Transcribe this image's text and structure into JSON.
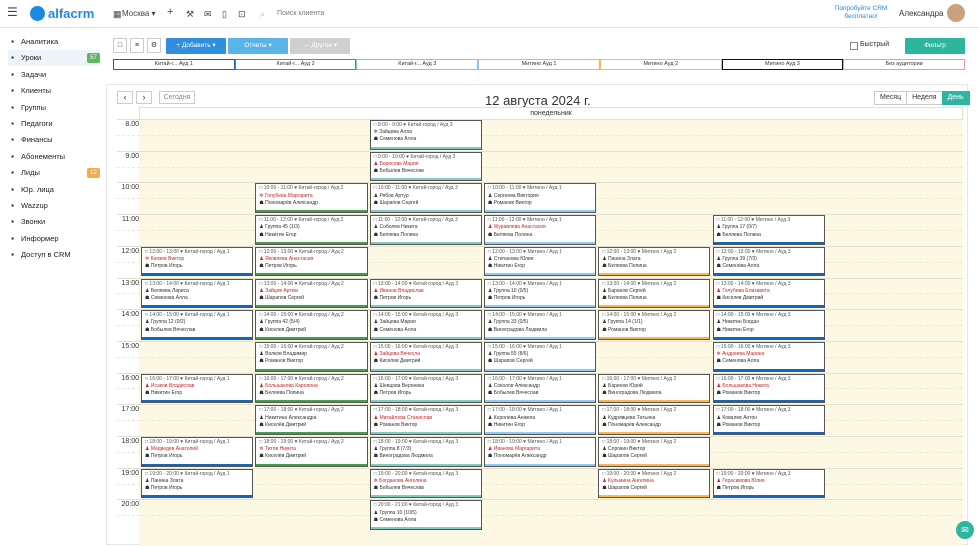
{
  "header": {
    "logo": "alfacrm",
    "city": "Москва",
    "search_placeholder": "Поиск клиента",
    "promo": "Попробуйте CRM бесплатно!",
    "user": "Александра"
  },
  "sidebar": [
    {
      "label": "Аналитика",
      "icon": "analytics-icon"
    },
    {
      "label": "Уроки",
      "icon": "lessons-icon",
      "badge": "57",
      "badge_color": "#5cb85c",
      "active": true
    },
    {
      "label": "Задачи",
      "icon": "tasks-icon"
    },
    {
      "label": "Клиенты",
      "icon": "clients-icon"
    },
    {
      "label": "Группы",
      "icon": "groups-icon"
    },
    {
      "label": "Педагоги",
      "icon": "teachers-icon"
    },
    {
      "label": "Финансы",
      "icon": "finance-icon"
    },
    {
      "label": "Абонементы",
      "icon": "subscriptions-icon"
    },
    {
      "label": "Лиды",
      "icon": "leads-icon",
      "badge": "12",
      "badge_color": "#f0ad4e"
    },
    {
      "label": "Юр. лица",
      "icon": "legal-icon"
    },
    {
      "label": "Wazzup",
      "icon": "wazzup-icon"
    },
    {
      "label": "Звонки",
      "icon": "calls-icon"
    },
    {
      "label": "Информер",
      "icon": "informer-icon"
    },
    {
      "label": "Доступ в CRM",
      "icon": "lock-icon"
    }
  ],
  "toolbar": {
    "add": "+ Добавить ▾",
    "reports": "Отчеты ▾",
    "other": "— Другое ▾",
    "quick": "Быстрый",
    "filter": "Фильтр"
  },
  "rooms": [
    {
      "label": "Китай-г... Ауд 1",
      "color": "#1565c0"
    },
    {
      "label": "Китай-г... Ауд 2",
      "color": "#43a047"
    },
    {
      "label": "Китай-г... Ауд 3",
      "color": "#80cbc4"
    },
    {
      "label": "Митино Ауд 1",
      "color": "#90caf9"
    },
    {
      "label": "Митино Ауд 2",
      "color": "#ffb74d"
    },
    {
      "label": "Митино Ауд 3",
      "color": "#111111"
    },
    {
      "label": "Без аудитории",
      "color": "#ef9a9a"
    }
  ],
  "calendar": {
    "today": "Сегодня",
    "title": "12 августа 2024 г.",
    "views": [
      "Месяц",
      "Неделя",
      "День"
    ],
    "active_view": "День",
    "day": "понедельник",
    "hours": [
      "8.00",
      "9.00",
      "10:00",
      "11:00",
      "12:00",
      "13:00",
      "14:00",
      "15:00",
      "16:00",
      "17:00",
      "18:00",
      "19:00",
      "20:00"
    ]
  },
  "lessons": [
    {
      "c": 2,
      "h": 0,
      "l": [
        "□ 8:00 - 9:00 ♥ Китай-город / Ауд 3",
        "✲ Зайцева Алла",
        "☗ Семенова Алла"
      ],
      "red": []
    },
    {
      "c": 2,
      "h": 1,
      "l": [
        "□ 9:00 - 10:00 ♥ Китай-город / Ауд 3",
        "♟ Борисова Мария",
        "☗ Бобылев Вячеслав"
      ],
      "red": [
        1
      ]
    },
    {
      "c": 1,
      "h": 2,
      "l": [
        "□ 10:00 - 11:00 ♥ Китай-город / Ауд 2",
        "✲ Голубева Маргарита",
        "☗ Пономарёв Александр"
      ],
      "red": [
        1
      ]
    },
    {
      "c": 2,
      "h": 2,
      "l": [
        "□ 10:00 - 11:00 ♥ Китай-город / Ауд 3",
        "♟ Рябов Артур",
        "☗ Шарапов Сергей"
      ],
      "red": []
    },
    {
      "c": 3,
      "h": 2,
      "l": [
        "□ 10:00 - 11:00 ♥ Митино / Ауд 1",
        "♟ Сергеева Виктория",
        "☗ Романов Виктор"
      ],
      "red": []
    },
    {
      "c": 1,
      "h": 3,
      "l": [
        "□ 11:00 - 12:00 ♥ Китай-город / Ауд 2",
        "♟ Группа 45 (1/3)",
        "☗ Никитин Егор"
      ],
      "red": []
    },
    {
      "c": 2,
      "h": 3,
      "l": [
        "□ 11:00 - 12:00 ♥ Китай-город / Ауд 3",
        "♟ Соболев Никита",
        "☗ Беляева Полина"
      ],
      "red": []
    },
    {
      "c": 3,
      "h": 3,
      "l": [
        "□ 11:00 - 12:00 ♥ Митино / Ауд 1",
        "♟ Журавлева Анастасия",
        "☗ Беляева Полина"
      ],
      "red": [
        1
      ]
    },
    {
      "c": 5,
      "h": 3,
      "l": [
        "□ 11:00 - 12:00 ♥ Митино / Ауд 3",
        "♟ Группа 17 (0/7)",
        "☗ Беляева Полина"
      ],
      "red": []
    },
    {
      "c": 0,
      "h": 4,
      "l": [
        "□ 12:00 - 13:00 ♥ Китай-город / Ауд 1",
        "✲ Князев Виктор",
        "☗ Петров Игорь"
      ],
      "red": [
        1
      ]
    },
    {
      "c": 1,
      "h": 4,
      "l": [
        "□ 12:00 - 13:00 ♥ Китай-город / Ауд 2",
        "♟ Яковлева Анастасия",
        "☗ Петров Игорь"
      ],
      "red": [
        1
      ]
    },
    {
      "c": 3,
      "h": 4,
      "l": [
        "□ 12:00 - 13:00 ♥ Митино / Ауд 1",
        "♟ Степанова Юлия",
        "☗ Никитин Егор"
      ],
      "red": []
    },
    {
      "c": 4,
      "h": 4,
      "l": [
        "□ 12:00 - 13:00 ♥ Митино / Ауд 2",
        "♟ Панина Злата",
        "☗ Беляева Полина"
      ],
      "red": []
    },
    {
      "c": 5,
      "h": 4,
      "l": [
        "□ 12:00 - 13:00 ♥ Митино / Ауд 3",
        "♟ Группа 39 (7/3)",
        "☗ Семенова Алла"
      ],
      "red": []
    },
    {
      "c": 0,
      "h": 5,
      "l": [
        "□ 13:00 - 14:00 ♥ Китай-город / Ауд 1",
        "♟ Беляева Лариса",
        "☗ Семенова Алла"
      ],
      "red": []
    },
    {
      "c": 1,
      "h": 5,
      "l": [
        "□ 13:00 - 14:00 ♥ Китай-город / Ауд 2",
        "♟ Зайцев Артем",
        "☗ Шарапов Сергей"
      ],
      "red": [
        1
      ]
    },
    {
      "c": 2,
      "h": 5,
      "l": [
        "□ 13:00 - 14:00 ♥ Китай-город / Ауд 3",
        "♟ Иванов Владислав",
        "☗ Петров Игорь"
      ],
      "red": [
        1
      ]
    },
    {
      "c": 3,
      "h": 5,
      "l": [
        "□ 13:00 - 14:00 ♥ Митино / Ауд 1",
        "♟ Группа 10 (0/5)",
        "☗ Петров Игорь"
      ],
      "red": []
    },
    {
      "c": 4,
      "h": 5,
      "l": [
        "□ 13:00 - 14:00 ♥ Митино / Ауд 2",
        "♟ Баранов Сергей",
        "☗ Беляева Полина"
      ],
      "red": []
    },
    {
      "c": 5,
      "h": 5,
      "l": [
        "□ 13:00 - 14:00 ♥ Митино / Ауд 3",
        "♟ Голубева Елизавета",
        "☗ Киселев Дмитрий"
      ],
      "red": [
        1
      ]
    },
    {
      "c": 0,
      "h": 6,
      "l": [
        "□ 14:00 - 15:00 ♥ Китай-город / Ауд 1",
        "♟ Группа 12 (0/2)",
        "☗ Бобылев Вячеслав"
      ],
      "red": []
    },
    {
      "c": 1,
      "h": 6,
      "l": [
        "□ 14:00 - 15:00 ♥ Китай-город / Ауд 2",
        "♟ Группа 42 (5/4)",
        "☗ Киселев Дмитрий"
      ],
      "red": []
    },
    {
      "c": 2,
      "h": 6,
      "l": [
        "□ 14:00 - 15:00 ♥ Китай-город / Ауд 3",
        "♟ Зайцева Мария",
        "☗ Семенова Алла"
      ],
      "red": []
    },
    {
      "c": 3,
      "h": 6,
      "l": [
        "□ 14:00 - 15:00 ♥ Митино / Ауд 1",
        "♟ Группа 33 (0/5)",
        "☗ Виноградова Людмила"
      ],
      "red": []
    },
    {
      "c": 4,
      "h": 6,
      "l": [
        "□ 14:00 - 15:00 ♥ Митино / Ауд 2",
        "♟ Группа 14 (1/1)",
        "☗ Романов Виктор"
      ],
      "red": []
    },
    {
      "c": 5,
      "h": 6,
      "l": [
        "□ 14:00 - 15:00 ♥ Митино / Ауд 3",
        "♟ Никитин Богдан",
        "☗ Никитин Егор"
      ],
      "red": []
    },
    {
      "c": 1,
      "h": 7,
      "l": [
        "□ 15:00 - 16:00 ♥ Китай-город / Ауд 2",
        "♟ Волков Владимир",
        "☗ Романов Виктор"
      ],
      "red": []
    },
    {
      "c": 2,
      "h": 7,
      "l": [
        "□ 15:00 - 16:00 ♥ Китай-город / Ауд 3",
        "♟ Зайцева Вячесла",
        "☗ Киселев Дмитрий"
      ],
      "red": [
        1
      ]
    },
    {
      "c": 3,
      "h": 7,
      "l": [
        "□ 15:00 - 16:00 ♥ Митино / Ауд 1",
        "♟ Группа 55 (8/6)",
        "☗ Шарапов Сергей"
      ],
      "red": []
    },
    {
      "c": 5,
      "h": 7,
      "l": [
        "□ 15:00 - 16:00 ♥ Митино / Ауд 3",
        "✲ Андреева Марина",
        "☗ Семенова Алла"
      ],
      "red": [
        1
      ]
    },
    {
      "c": 0,
      "h": 8,
      "l": [
        "□ 16:00 - 17:00 ♥ Китай-город / Ауд 1",
        "♟ Исаков Владислав",
        "☗ Никитин Егор"
      ],
      "red": [
        1
      ]
    },
    {
      "c": 1,
      "h": 8,
      "l": [
        "□ 16:00 - 17:00 ♥ Китай-город / Ауд 2",
        "♟ Большакова Каролина",
        "☗ Беляева Полина"
      ],
      "red": [
        1
      ]
    },
    {
      "c": 2,
      "h": 8,
      "l": [
        "□ 16:00 - 17:00 ♥ Китай-город / Ауд 3",
        "♟ Шевцова Вероника",
        "☗ Петров Игорь"
      ],
      "red": []
    },
    {
      "c": 3,
      "h": 8,
      "l": [
        "□ 16:00 - 17:00 ♥ Митино / Ауд 1",
        "♟ Соколов Александр",
        "☗ Бобылев Вячеслав"
      ],
      "red": []
    },
    {
      "c": 4,
      "h": 8,
      "l": [
        "□ 16:00 - 17:00 ♥ Митино / Ауд 2",
        "♟ Баринов Юрий",
        "☗ Виноградова Людмила"
      ],
      "red": []
    },
    {
      "c": 5,
      "h": 8,
      "l": [
        "□ 16:00 - 17:00 ♥ Митино / Ауд 3",
        "♟ Большакова Никита",
        "☗ Романов Виктор"
      ],
      "red": [
        1
      ]
    },
    {
      "c": 1,
      "h": 9,
      "l": [
        "□ 17:00 - 18:00 ♥ Китай-город / Ауд 2",
        "♟ Никитина Александра",
        "☗ Киселёв Дмитрий"
      ],
      "red": []
    },
    {
      "c": 2,
      "h": 9,
      "l": [
        "□ 17:00 - 18:00 ♥ Китай-город / Ауд 3",
        "♟ Михайлова Станислав",
        "☗ Романов Виктор"
      ],
      "red": [
        1
      ]
    },
    {
      "c": 3,
      "h": 9,
      "l": [
        "□ 17:00 - 18:00 ♥ Митино / Ауд 1",
        "♟ Королева Анжела",
        "☗ Никитин Егор"
      ],
      "red": []
    },
    {
      "c": 4,
      "h": 9,
      "l": [
        "□ 17:00 - 18:00 ♥ Митино / Ауд 2",
        "♟ Кудрявцева Татьяна",
        "☗ Пономарёв Александр"
      ],
      "red": []
    },
    {
      "c": 5,
      "h": 9,
      "l": [
        "□ 17:00 - 18:00 ♥ Митино / Ауд 3",
        "♟ Ковалев Антон",
        "☗ Романов Виктор"
      ],
      "red": []
    },
    {
      "c": 0,
      "h": 10,
      "l": [
        "□ 18:00 - 19:00 ♥ Китай-город / Ауд 1",
        "♟ Медведев Анатолий",
        "☗ Петров Игорь"
      ],
      "red": [
        1
      ]
    },
    {
      "c": 1,
      "h": 10,
      "l": [
        "□ 18:00 - 19:00 ♥ Китай-город / Ауд 2",
        "✲ Титов Никита",
        "☗ Киселёв Дмитрий"
      ],
      "red": [
        1
      ]
    },
    {
      "c": 2,
      "h": 10,
      "l": [
        "□ 18:00 - 19:00 ♥ Китай-город / Ауд 3",
        "♟ Группа 8 (7/3)",
        "☗ Виноградова Людмила"
      ],
      "red": []
    },
    {
      "c": 3,
      "h": 10,
      "l": [
        "□ 18:00 - 19:00 ♥ Митино / Ауд 1",
        "♟ Иванова Маргарита",
        "☗ Пономарёв Александр"
      ],
      "red": [
        1
      ]
    },
    {
      "c": 4,
      "h": 10,
      "l": [
        "□ 18:00 - 19:00 ♥ Митино / Ауд 2",
        "♟ Сорокин Виктор",
        "☗ Шарапов Сергей"
      ],
      "red": []
    },
    {
      "c": 0,
      "h": 11,
      "l": [
        "□ 19:00 - 20:00 ♥ Китай-город / Ауд 1",
        "♟ Панина Злата",
        "☗ Петров Игорь"
      ],
      "red": []
    },
    {
      "c": 2,
      "h": 11,
      "l": [
        "□ 19:00 - 20:00 ♥ Китай-город / Ауд 3",
        "✲ Богданова Ангелина",
        "☗ Бобылев Вячеслав"
      ],
      "red": [
        1
      ]
    },
    {
      "c": 4,
      "h": 11,
      "l": [
        "□ 19:00 - 20:00 ♥ Митино / Ауд 2",
        "♟ Кульмина Ангелина",
        "☗ Шарапов Сергей"
      ],
      "red": [
        1
      ]
    },
    {
      "c": 5,
      "h": 11,
      "l": [
        "□ 19:00 - 20:00 ♥ Митино / Ауд 3",
        "♟ Герасимова Юлия",
        "☗ Петров Игорь"
      ],
      "red": [
        1
      ]
    },
    {
      "c": 2,
      "h": 12,
      "l": [
        "□ 20:00 - 21:00 ♥ Китай-город / Ауд 3",
        "♟ Группа 10 (10/5)",
        "☗ Семенова Алла"
      ],
      "red": []
    }
  ]
}
